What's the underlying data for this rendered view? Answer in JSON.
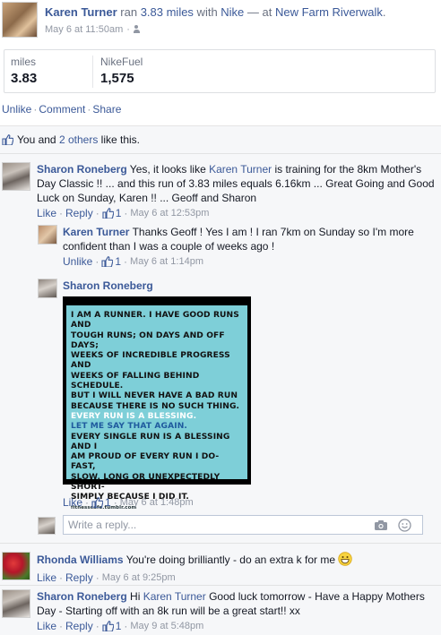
{
  "post": {
    "author": "Karen Turner",
    "activity_text": " ran ",
    "distance_link": "3.83 miles",
    "with_text": " with ",
    "app_link": "Nike",
    "at_text": " — at ",
    "place_link": "New Farm Riverwalk",
    "place_suffix": ".",
    "timestamp": "May 6 at 11:50am",
    "timestamp_sep": " · ",
    "privacy_icon": "friends-icon"
  },
  "stats": [
    {
      "label": "miles",
      "value": "3.83"
    },
    {
      "label": "NikeFuel",
      "value": "1,575"
    }
  ],
  "post_actions": {
    "unlike": "Unlike",
    "comment": "Comment",
    "share": "Share",
    "sep": "·"
  },
  "likes": {
    "prefix": "You and ",
    "others_link": "2 others",
    "suffix": " like this."
  },
  "comments": [
    {
      "author": "Sharon Roneberg",
      "text_before": " Yes, it looks like ",
      "mention": "Karen Turner",
      "text_after": " is training for the 8km Mother's Day Classic !! ... and this run of 3.83 miles equals 6.16km ... Great Going and Good Luck on Sunday, Karen !! ... Geoff and Sharon",
      "like_label": "Like",
      "reply_label": "Reply",
      "like_count": "1",
      "timestamp": "May 6 at 12:53pm"
    },
    {
      "author": "Karen Turner",
      "text": " Thanks Geoff ! Yes I am ! I ran 7km on Sunday so I'm more confident than I was a couple of weeks ago !",
      "like_label": "Unlike",
      "like_count": "1",
      "timestamp": "May 6 at 1:14pm"
    },
    {
      "author": "Sharon Roneberg",
      "like_label": "Like",
      "like_count": "1",
      "timestamp": "May 6 at 1:48pm",
      "image_lines": [
        {
          "text": "I AM A RUNNER. I HAVE GOOD RUNS AND",
          "style": "blk"
        },
        {
          "text": "TOUGH RUNS; ON DAYS AND OFF DAYS;",
          "style": "blk"
        },
        {
          "text": "WEEKS OF INCREDIBLE PROGRESS AND",
          "style": "blk"
        },
        {
          "text": "WEEKS OF FALLING BEHIND SCHEDULE.",
          "style": "blk"
        },
        {
          "text": "BUT I WILL NEVER HAVE A BAD RUN",
          "style": "blk"
        },
        {
          "text": "BECAUSE THERE IS NO SUCH THING.",
          "style": "blk"
        },
        {
          "text": "EVERY RUN IS A BLESSING.",
          "style": "wht"
        },
        {
          "text": "LET ME SAY THAT AGAIN.",
          "style": "blu"
        },
        {
          "text": "EVERY SINGLE RUN IS A BLESSING AND I",
          "style": "blk"
        },
        {
          "text": "AM PROUD OF EVERY RUN I DO- FAST,",
          "style": "blk"
        },
        {
          "text": "SLOW, LONG OR UNEXPECTEDLY SHORT-",
          "style": "blk"
        },
        {
          "text": "SIMPLY BECAUSE I DID IT.",
          "style": "blk"
        }
      ],
      "image_source": "fitnesscafe.tumblr.com"
    },
    {
      "author": "Rhonda Williams",
      "text": " You're doing brilliantly - do an extra k for me ",
      "like_label": "Like",
      "reply_label": "Reply",
      "timestamp": "May 6 at 9:25pm"
    },
    {
      "author": "Sharon Roneberg",
      "text_before": " Hi ",
      "mention": "Karen Turner",
      "text_after": " Good luck tomorrow - Have a Happy Mothers Day - Starting off with an 8k run will be a great start!! xx",
      "like_label": "Like",
      "reply_label": "Reply",
      "like_count": "1",
      "timestamp": "May 9 at 5:48pm"
    }
  ],
  "reply_box": {
    "placeholder": "Write a reply...",
    "camera_icon": "camera-icon",
    "emoji_icon": "smiley-icon"
  },
  "sep": " · "
}
